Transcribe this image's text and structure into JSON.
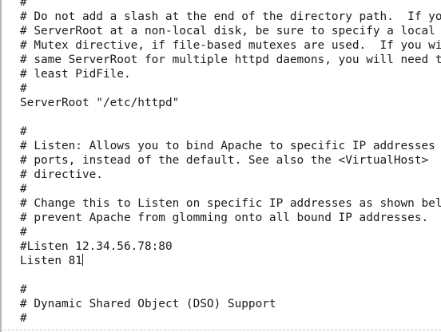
{
  "editor": {
    "lines": [
      "#",
      "# Do not add a slash at the end of the directory path.  If you point",
      "# ServerRoot at a non-local disk, be sure to specify a local disk on the",
      "# Mutex directive, if file-based mutexes are used.  If you wish to share the",
      "# same ServerRoot for multiple httpd daemons, you will need to change at",
      "# least PidFile.",
      "#",
      "ServerRoot \"/etc/httpd\"",
      "",
      "#",
      "# Listen: Allows you to bind Apache to specific IP addresses and/or",
      "# ports, instead of the default. See also the <VirtualHost>",
      "# directive.",
      "#",
      "# Change this to Listen on specific IP addresses as shown below to",
      "# prevent Apache from glomming onto all bound IP addresses.",
      "#",
      "#Listen 12.34.56.78:80",
      "Listen 81",
      "",
      "#",
      "# Dynamic Shared Object (DSO) Support",
      "#"
    ],
    "cursor_line": 18
  }
}
